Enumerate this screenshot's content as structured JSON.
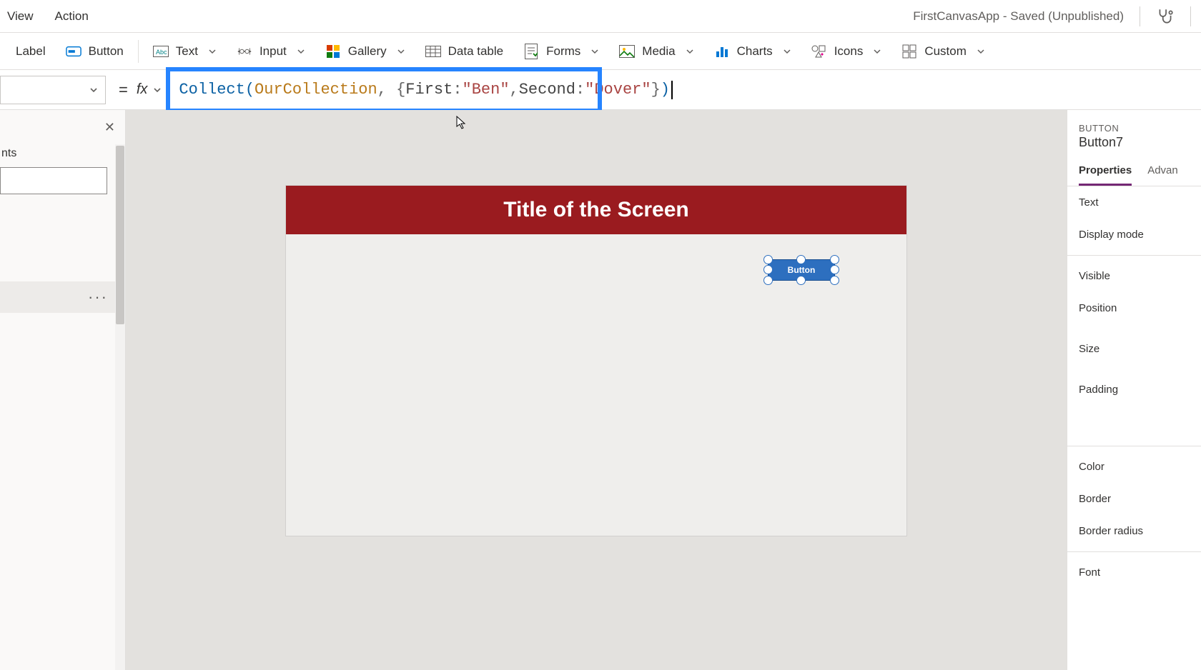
{
  "menu": {
    "view": "View",
    "action": "Action"
  },
  "app_title": "FirstCanvasApp - Saved (Unpublished)",
  "ribbon": {
    "label": "Label",
    "button": "Button",
    "text": "Text",
    "input": "Input",
    "gallery": "Gallery",
    "data_table": "Data table",
    "forms": "Forms",
    "media": "Media",
    "charts": "Charts",
    "icons": "Icons",
    "custom": "Custom"
  },
  "formula": {
    "fn": "Collect",
    "id": "OurCollection",
    "k1": "First",
    "v1": "\"Ben\"",
    "k2": "Second",
    "v2": "\"Dover\""
  },
  "left": {
    "label_suffix": "nts",
    "ellipsis": "···"
  },
  "canvas": {
    "title": "Title of the Screen",
    "button_text": "Button"
  },
  "props": {
    "type": "BUTTON",
    "name": "Button7",
    "tab_properties": "Properties",
    "tab_advanced": "Advan",
    "rows": {
      "text": "Text",
      "display_mode": "Display mode",
      "visible": "Visible",
      "position": "Position",
      "size": "Size",
      "padding": "Padding",
      "color": "Color",
      "border": "Border",
      "border_radius": "Border radius",
      "font": "Font"
    }
  }
}
